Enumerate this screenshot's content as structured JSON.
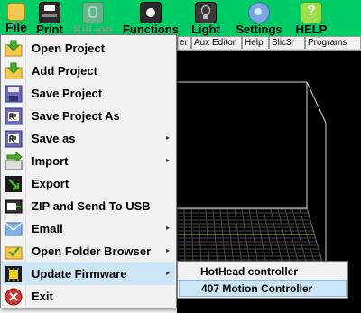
{
  "toolbar": {
    "file": "File",
    "print": "Print",
    "kill_job": "Kill job",
    "functions": "Functions",
    "light": "Light",
    "settings": "Settings",
    "help": "HELP"
  },
  "tabs": [
    "er",
    "Aux Editor",
    "Help",
    "Slic3r",
    "Programs"
  ],
  "file_menu": {
    "items": [
      {
        "label": "Open Project",
        "icon": "folder-open-arrow-icon"
      },
      {
        "label": "Add Project",
        "icon": "folder-add-arrow-icon"
      },
      {
        "label": "Save Project",
        "icon": "floppy-disk-icon"
      },
      {
        "label": "Save Project As",
        "icon": "floppy-disk-rename-icon"
      },
      {
        "label": "Save as",
        "icon": "floppy-disk-rename-icon"
      },
      {
        "label": "Import",
        "icon": "import-arrow-icon"
      },
      {
        "label": "Export",
        "icon": "export-icon"
      },
      {
        "label": "ZIP and Send To USB",
        "icon": "usb-zip-icon"
      },
      {
        "label": "Email",
        "icon": "envelope-icon"
      },
      {
        "label": "Open Folder Browser",
        "icon": "folder-check-icon"
      },
      {
        "label": "Update Firmware",
        "icon": "chip-icon"
      },
      {
        "label": "Exit",
        "icon": "exit-icon"
      }
    ]
  },
  "submenu": {
    "items": [
      "HotHead controller",
      "407 Motion Controller"
    ]
  },
  "colors": {
    "toolbar_bg": "#00cc66",
    "menu_highlight": "#cde6f7",
    "viewport_bg": "#000000",
    "grid_color": "#5a5a5a"
  }
}
